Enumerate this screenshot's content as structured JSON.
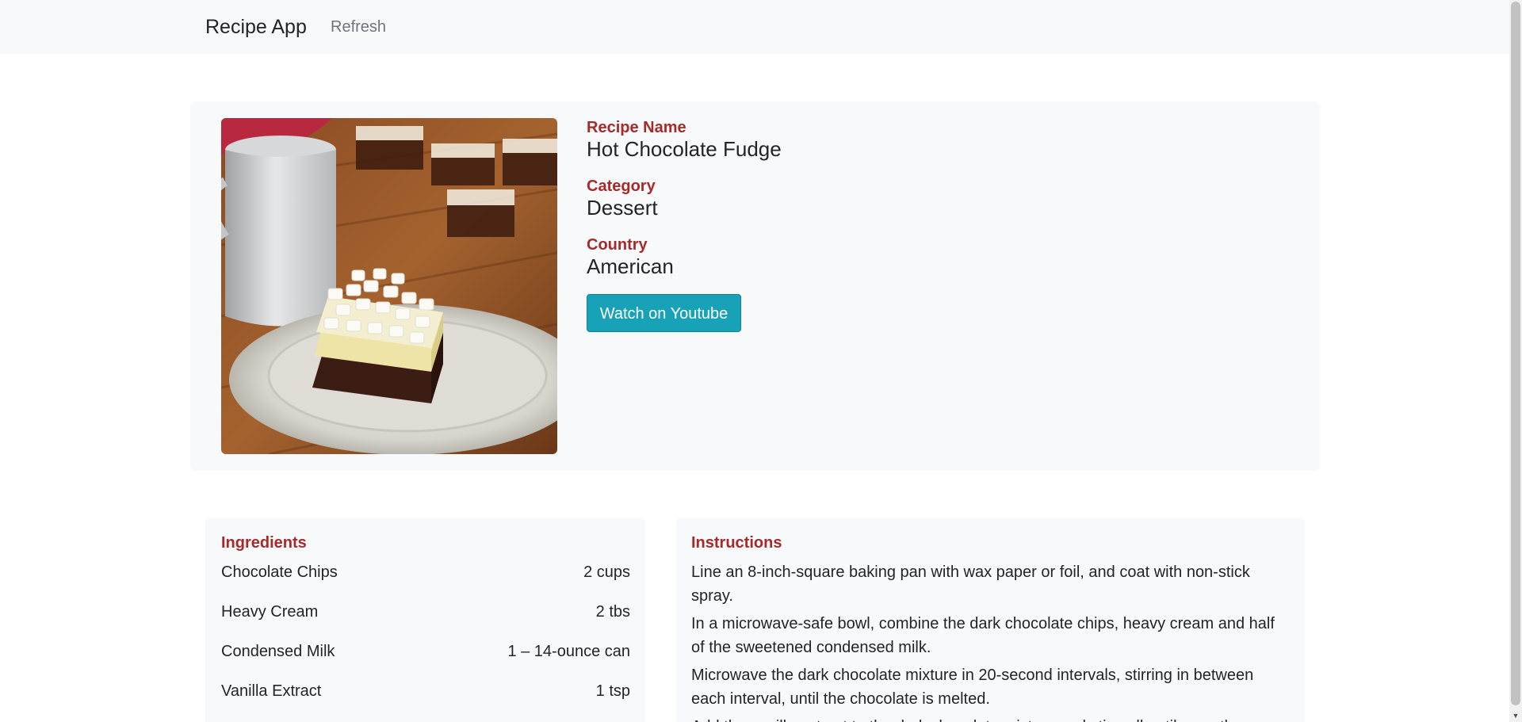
{
  "navbar": {
    "brand": "Recipe App",
    "refresh_label": "Refresh"
  },
  "recipe": {
    "name_label": "Recipe Name",
    "name": "Hot Chocolate Fudge",
    "category_label": "Category",
    "category": "Dessert",
    "country_label": "Country",
    "country": "American",
    "youtube_button": "Watch on Youtube",
    "accent_color": "#a52a2a",
    "button_color": "#17a2b8"
  },
  "ingredients": {
    "title": "Ingredients",
    "items": [
      {
        "name": "Chocolate Chips",
        "qty": "2 cups"
      },
      {
        "name": "Heavy Cream",
        "qty": "2 tbs"
      },
      {
        "name": "Condensed Milk",
        "qty": "1 – 14-ounce can"
      },
      {
        "name": "Vanilla Extract",
        "qty": "1 tsp"
      }
    ]
  },
  "instructions": {
    "title": "Instructions",
    "steps": [
      "Line an 8-inch-square baking pan with wax paper or foil, and coat with non-stick spray.",
      "In a microwave-safe bowl, combine the dark chocolate chips, heavy cream and half of the sweetened condensed milk.",
      "Microwave the dark chocolate mixture in 20-second intervals, stirring in between each interval, until the chocolate is melted.",
      "Add the vanilla extract to the dark chocolate mixture and stir well until smooth."
    ]
  }
}
